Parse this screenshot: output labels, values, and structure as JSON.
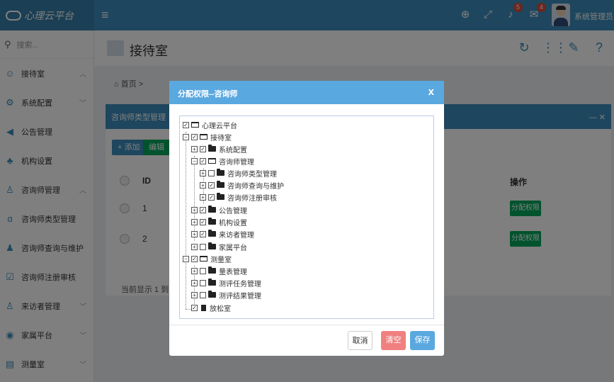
{
  "app": {
    "logo_text": "心理云平台",
    "user_name": "系统管理员",
    "badges": {
      "notifications": "5",
      "messages": "4"
    }
  },
  "sidebar": {
    "search_placeholder": "搜索...",
    "items": [
      {
        "label": "接待室",
        "icon": "user-group-icon"
      },
      {
        "label": "系统配置",
        "icon": "gear-icon"
      },
      {
        "label": "公告管理",
        "icon": "megaphone-icon"
      },
      {
        "label": "机构设置",
        "icon": "sitemap-icon"
      },
      {
        "label": "咨询师管理",
        "icon": "user-icon"
      },
      {
        "label": "咨询师类型管理",
        "icon": "tag-icon"
      },
      {
        "label": "咨询师查询与维护",
        "icon": "user-tie-icon"
      },
      {
        "label": "咨询师注册审核",
        "icon": "check-square-icon"
      },
      {
        "label": "来访者管理",
        "icon": "user-icon"
      },
      {
        "label": "家属平台",
        "icon": "eye-icon"
      },
      {
        "label": "测量室",
        "icon": "list-icon"
      }
    ]
  },
  "page": {
    "title": "接待室",
    "breadcrumb": "首页 >",
    "box_title": "咨询师类型管理",
    "add_label": "+ 添加",
    "edit_label": "编辑",
    "columns": {
      "id": "ID",
      "action": "操作"
    },
    "rows": [
      {
        "id": "1",
        "action": "分配权限"
      },
      {
        "id": "2",
        "action": "分配权限"
      }
    ],
    "footer": "当前显示 1 到 2 行"
  },
  "modal": {
    "title": "分配权限--咨询师",
    "close": "x",
    "tree": [
      {
        "label": "心理云平台",
        "checked": true
      },
      {
        "label": "接待室",
        "checked": true
      },
      {
        "label": "系统配置",
        "checked": true
      },
      {
        "label": "咨询师管理",
        "checked": true
      },
      {
        "label": "咨询师类型管理",
        "checked": false
      },
      {
        "label": "咨询师查询与维护",
        "checked": true
      },
      {
        "label": "咨询师注册审核",
        "checked": true
      },
      {
        "label": "公告管理",
        "checked": true
      },
      {
        "label": "机构设置",
        "checked": true
      },
      {
        "label": "来访者管理",
        "checked": true
      },
      {
        "label": "家属平台",
        "checked": false
      },
      {
        "label": "测量室",
        "checked": true
      },
      {
        "label": "量表管理",
        "checked": false
      },
      {
        "label": "测评任务管理",
        "checked": false
      },
      {
        "label": "测评结果管理",
        "checked": false
      },
      {
        "label": "放松室",
        "checked": true
      }
    ],
    "buttons": {
      "cancel": "取消",
      "clear": "清空",
      "save": "保存"
    }
  },
  "colors": {
    "topbar": "#3c8dbc",
    "modal_header": "#5aa8e0",
    "clear_button": "#f08080",
    "save_button": "#5aa8e0",
    "assign_button": "#00a65a"
  }
}
